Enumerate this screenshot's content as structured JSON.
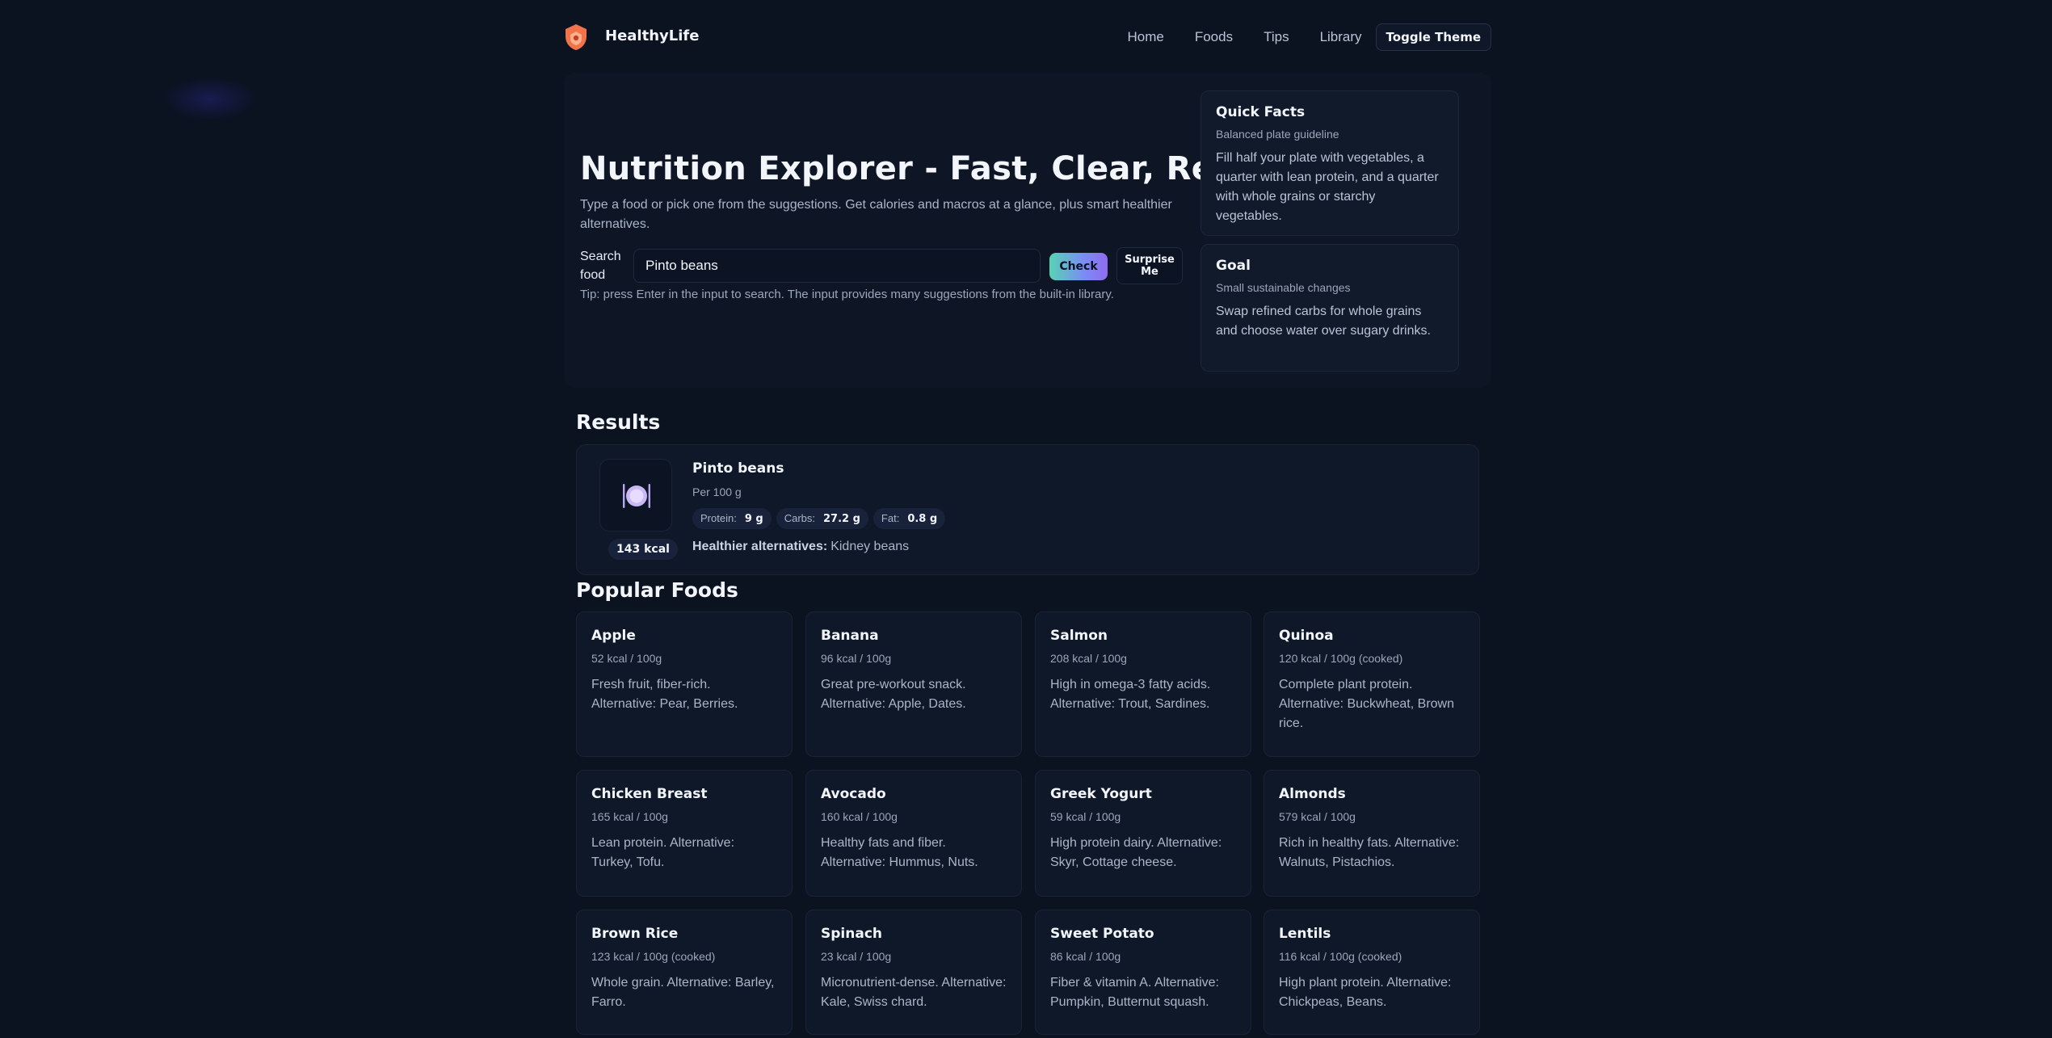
{
  "nav": {
    "brand": "HealthyLife",
    "links": [
      "Home",
      "Foods",
      "Tips",
      "Library"
    ],
    "toggle_label": "Toggle Theme"
  },
  "hero": {
    "title": "Nutrition Explorer - Fast, Clear, Reliable",
    "subtitle": "Type a food or pick one from the suggestions. Get calories and macros at a glance, plus smart healthier alternatives.",
    "search_label": "Search food",
    "search_value": "Pinto beans",
    "check_label": "Check",
    "surprise_label": "Surprise Me",
    "tip": "Tip: press Enter in the input to search. The input provides many suggestions from the built-in library."
  },
  "facts": [
    {
      "title": "Quick Facts",
      "subtitle": "Balanced plate guideline",
      "body": "Fill half your plate with vegetables, a quarter with lean protein, and a quarter with whole grains or starchy vegetables."
    },
    {
      "title": "Goal",
      "subtitle": "Small sustainable changes",
      "body": "Swap refined carbs for whole grains and choose water over sugary drinks."
    }
  ],
  "results": {
    "heading": "Results",
    "name": "Pinto beans",
    "per": "Per 100 g",
    "kcal": "143 kcal",
    "macros": [
      {
        "label": "Protein:",
        "value": "9 g"
      },
      {
        "label": "Carbs:",
        "value": "27.2 g"
      },
      {
        "label": "Fat:",
        "value": "0.8 g"
      }
    ],
    "alternatives_label": "Healthier alternatives:",
    "alternatives": "Kidney beans"
  },
  "popular": {
    "heading": "Popular Foods",
    "items": [
      {
        "name": "Apple",
        "kcal": "52 kcal / 100g",
        "desc": "Fresh fruit, fiber-rich. Alternative: Pear, Berries."
      },
      {
        "name": "Banana",
        "kcal": "96 kcal / 100g",
        "desc": "Great pre-workout snack. Alternative: Apple, Dates."
      },
      {
        "name": "Salmon",
        "kcal": "208 kcal / 100g",
        "desc": "High in omega-3 fatty acids. Alternative: Trout, Sardines."
      },
      {
        "name": "Quinoa",
        "kcal": "120 kcal / 100g (cooked)",
        "desc": "Complete plant protein. Alternative: Buckwheat, Brown rice."
      },
      {
        "name": "Chicken Breast",
        "kcal": "165 kcal / 100g",
        "desc": "Lean protein. Alternative: Turkey, Tofu."
      },
      {
        "name": "Avocado",
        "kcal": "160 kcal / 100g",
        "desc": "Healthy fats and fiber. Alternative: Hummus, Nuts."
      },
      {
        "name": "Greek Yogurt",
        "kcal": "59 kcal / 100g",
        "desc": "High protein dairy. Alternative: Skyr, Cottage cheese."
      },
      {
        "name": "Almonds",
        "kcal": "579 kcal / 100g",
        "desc": "Rich in healthy fats. Alternative: Walnuts, Pistachios."
      },
      {
        "name": "Brown Rice",
        "kcal": "123 kcal / 100g (cooked)",
        "desc": "Whole grain. Alternative: Barley, Farro."
      },
      {
        "name": "Spinach",
        "kcal": "23 kcal / 100g",
        "desc": "Micronutrient-dense. Alternative: Kale, Swiss chard."
      },
      {
        "name": "Sweet Potato",
        "kcal": "86 kcal / 100g",
        "desc": "Fiber & vitamin A. Alternative: Pumpkin, Butternut squash."
      },
      {
        "name": "Lentils",
        "kcal": "116 kcal / 100g (cooked)",
        "desc": "High plant protein. Alternative: Chickpeas, Beans."
      }
    ]
  },
  "icons": {
    "logo": "heart-shield-icon",
    "result": "plate-cutlery-icon"
  },
  "colors": {
    "background": "#0b1220",
    "accent_start": "#57d3b4",
    "accent_end": "#8f6cf0",
    "logo": "#f0734a"
  }
}
